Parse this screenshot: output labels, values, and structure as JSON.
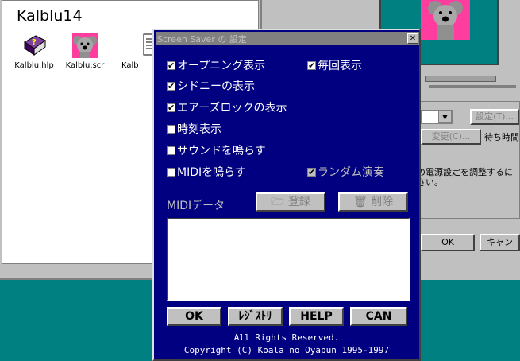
{
  "explorer": {
    "title": "Kalblu14",
    "files": [
      {
        "name": "Kalblu.hlp",
        "icon": "help-book-icon"
      },
      {
        "name": "Kalblu.scr",
        "icon": "koala-icon"
      },
      {
        "name": "Kalb",
        "icon": "text-file-icon"
      }
    ]
  },
  "display": {
    "settings_button": "設定(T)...",
    "change_button": "変更(C)...",
    "wait_label": "待ち時間",
    "power_text": "の電源設定を調整するに\nさい。",
    "ok_button": "OK",
    "cancel_button": "キャン"
  },
  "dialog": {
    "title": "Screen Saver の 設定",
    "close": "✕",
    "options": {
      "opening": "オープニング表示",
      "every_time": "毎回表示",
      "sydney": "シドニーの表示",
      "airslock": "エアーズロックの表示",
      "clock": "時刻表示",
      "sound": "サウンドを鳴らす",
      "midi": "MIDIを鳴らす",
      "random": "ランダム演奏"
    },
    "midi_label": "MIDIデータ",
    "register_button": "登録",
    "delete_button": "削除",
    "buttons": {
      "ok": "OK",
      "registry": "ﾚｼﾞｽﾄﾘ",
      "help": "HELP",
      "can": "CAN"
    },
    "copyright1": "All Rights Reserved.",
    "copyright2": "Copyright (C) Koala no Oyabun 1995-1997"
  },
  "colors": {
    "dialog_bg": "#000080",
    "desktop": "#008080",
    "preview_pink": "#ff3d9f"
  }
}
